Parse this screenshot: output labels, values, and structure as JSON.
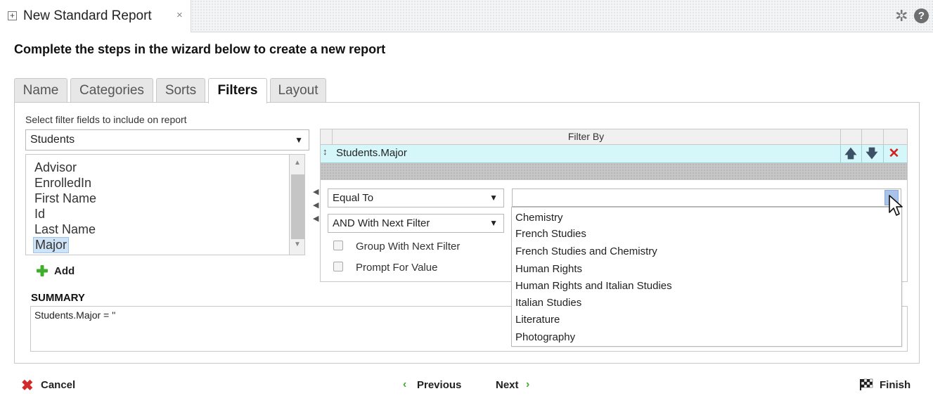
{
  "window": {
    "doc_title": "New Standard Report",
    "close_glyph": "×",
    "icons": [
      "expand-icon",
      "tools-icon",
      "help-icon"
    ]
  },
  "heading": "Complete the steps in the wizard below to create a new report",
  "tabs": [
    {
      "label": "Name",
      "active": false
    },
    {
      "label": "Categories",
      "active": false
    },
    {
      "label": "Sorts",
      "active": false
    },
    {
      "label": "Filters",
      "active": true
    },
    {
      "label": "Layout",
      "active": false
    }
  ],
  "field_picker": {
    "label": "Select filter fields to include on report",
    "source_value": "Students",
    "fields": [
      "Advisor",
      "EnrolledIn",
      "First Name",
      "Id",
      "Last Name",
      "Major"
    ],
    "selected_field": "Major",
    "add_label": "Add"
  },
  "filter_grid": {
    "header": "Filter By",
    "rows": [
      {
        "field": "Students.Major"
      }
    ]
  },
  "filter_editor": {
    "operator_value": "Equal To",
    "conjunction_value": "AND With Next Filter",
    "group_label": "Group With Next Filter",
    "group_checked": false,
    "prompt_label": "Prompt For Value",
    "prompt_checked": false,
    "value": "",
    "value_options": [
      "Chemistry",
      "French Studies",
      "French Studies and Chemistry",
      "Human Rights",
      "Human Rights and Italian Studies",
      "Italian Studies",
      "Literature",
      "Photography"
    ]
  },
  "summary": {
    "label": "SUMMARY",
    "text": "Students.Major = ''"
  },
  "footer": {
    "cancel_label": "Cancel",
    "previous_label": "Previous",
    "next_label": "Next",
    "finish_label": "Finish"
  },
  "colors": {
    "accent_green": "#3fae2a",
    "delete_red": "#d32020",
    "row_highlight": "#d6f7fa",
    "selected_field_bg": "#cfe3f7"
  }
}
